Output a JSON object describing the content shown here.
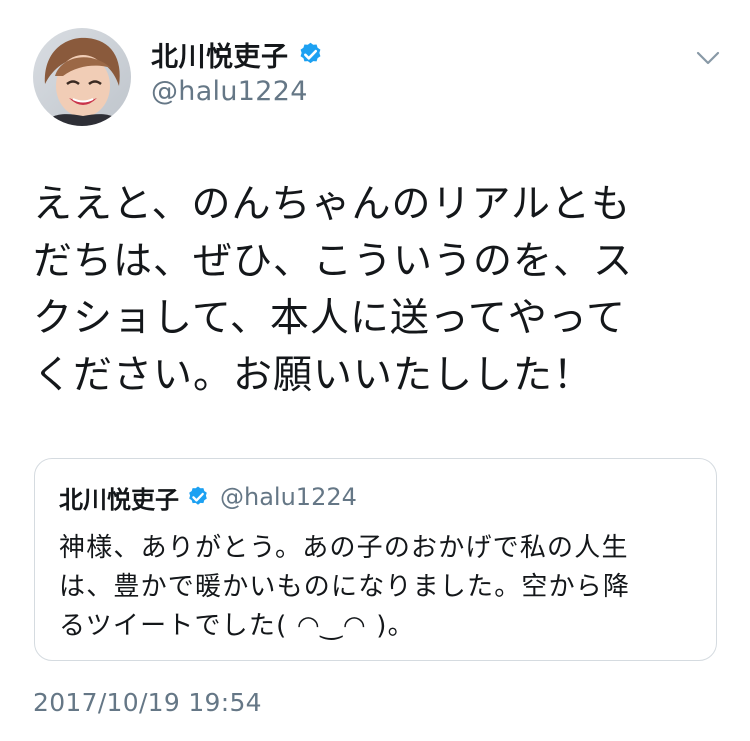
{
  "tweet": {
    "author_name": "北川悦吏子",
    "author_handle": "@halu1224",
    "text_lines": [
      "ええと、のんちゃんのリアルとも",
      "だちは、ぜひ、こういうのを、ス",
      "クショして、本人に送ってやって",
      "ください。お願いいたしした！"
    ],
    "timestamp": "2017/10/19 19:54",
    "verified_color": "#1da1f2"
  },
  "quoted_tweet": {
    "author_name": "北川悦吏子",
    "author_handle": "@halu1224",
    "text_lines": [
      "神様、ありがとう。あの子のおかげで私の人生",
      "は、豊かで暖かいものになりました。空から降",
      "るツイートでした( ◠‿◠ )。"
    ]
  },
  "icons": {
    "verified": "verified-badge-icon",
    "menu": "chevron-down-icon"
  },
  "colors": {
    "text": "#14171a",
    "secondary": "#657786",
    "border": "#d5dbe0"
  }
}
